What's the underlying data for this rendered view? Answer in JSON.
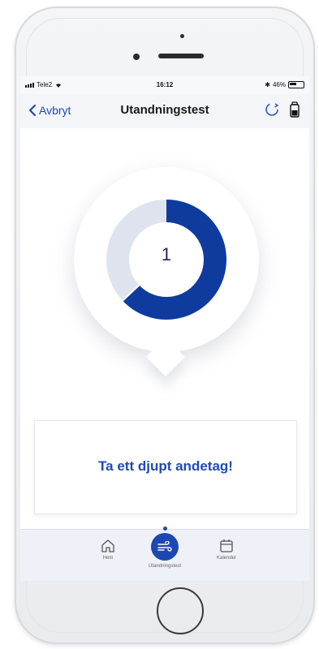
{
  "status": {
    "carrier": "Tele2",
    "time": "16:12",
    "battery_percent": "46%"
  },
  "nav": {
    "back_label": "Avbryt",
    "title": "Utandningstest"
  },
  "progress": {
    "count": "1",
    "fill_fraction": 0.63,
    "color_filled": "#0f3b9f",
    "color_remaining": "#dfe3ee"
  },
  "card": {
    "message": "Ta ett djupt andetag!"
  },
  "tabs": [
    {
      "label": "Hem",
      "icon": "home-icon"
    },
    {
      "label": "Utandningstest",
      "icon": "breath-icon"
    },
    {
      "label": "Kalender",
      "icon": "calendar-icon"
    }
  ],
  "colors": {
    "accent": "#1d47b2"
  }
}
